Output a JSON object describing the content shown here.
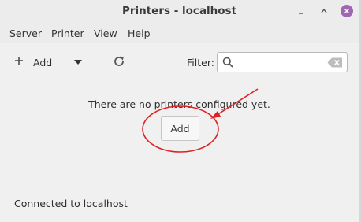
{
  "window": {
    "title": "Printers - localhost"
  },
  "menu": {
    "items": [
      "Server",
      "Printer",
      "View",
      "Help"
    ]
  },
  "toolbar": {
    "add_label": "Add",
    "filter_label": "Filter:",
    "filter_value": ""
  },
  "main": {
    "empty_message": "There are no printers configured yet.",
    "add_button_label": "Add"
  },
  "status": {
    "text": "Connected to localhost"
  },
  "colors": {
    "close_button": "#a066b3",
    "annotation": "#e02020"
  },
  "icons": [
    "minimize-icon",
    "maximize-icon",
    "close-icon",
    "plus-icon",
    "dropdown-caret-icon",
    "refresh-icon",
    "search-icon",
    "clear-icon"
  ]
}
